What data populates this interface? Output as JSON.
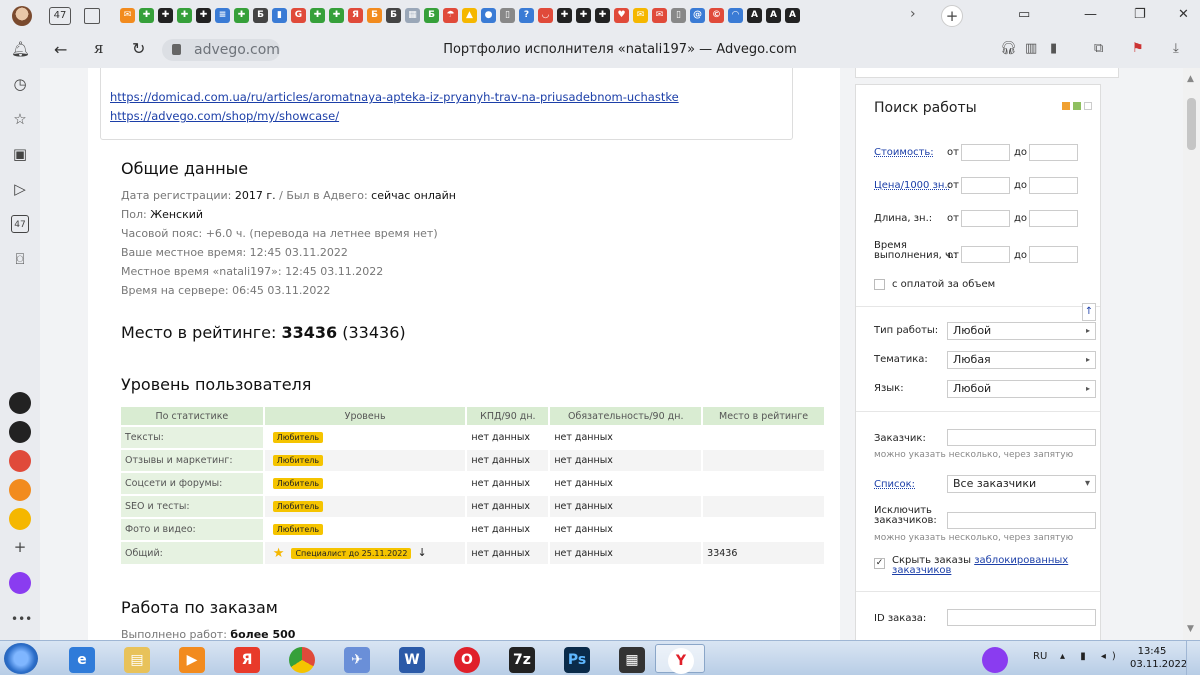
{
  "browser": {
    "tab_counter": "47",
    "url": "advego.com",
    "page_title": "Портфолио исполнителя «natali197» — Advego.com",
    "sidebar_counter": "47",
    "pinned_tab_count_text": "",
    "new_tab_symbol": "+",
    "tab_scroll_symbol": "›",
    "window_controls": [
      "▭",
      "—",
      "❐",
      "✕"
    ]
  },
  "links": [
    "https://domicad.com.ua/ru/articles/aromatnaya-apteka-iz-pryanyh-trav-na-priusadebnom-uchastke",
    "https://advego.com/shop/my/showcase/"
  ],
  "general": {
    "heading": "Общие данные",
    "reg_label": "Дата регистрации:",
    "reg_value": "2017 г.",
    "sep": "/",
    "seen_label": "Был в Адвего:",
    "seen_value": "сейчас онлайн",
    "gender_label": "Пол:",
    "gender_value": "Женский",
    "tz_line": "Часовой пояс: +6.0 ч. (перевода на летнее время нет)",
    "local_time_line": "Ваше местное время: 12:45 03.11.2022",
    "user_time_line": "Местное время «natali197»: 12:45 03.11.2022",
    "server_time_line": "Время на сервере: 06:45 03.11.2022"
  },
  "rating": {
    "label": "Место в рейтинге:",
    "value": "33436",
    "paren": "(33436)"
  },
  "level": {
    "heading": "Уровень пользователя",
    "columns": [
      "По статистике",
      "Уровень",
      "КПД/90 дн.",
      "Обязательность/90 дн.",
      "Место в рейтинге"
    ],
    "rows": [
      {
        "cat": "Тексты:",
        "level": "Любитель",
        "kpd": "нет данных",
        "oblig": "нет данных",
        "place": ""
      },
      {
        "cat": "Отзывы и маркетинг:",
        "level": "Любитель",
        "kpd": "нет данных",
        "oblig": "нет данных",
        "place": ""
      },
      {
        "cat": "Соцсети и форумы:",
        "level": "Любитель",
        "kpd": "нет данных",
        "oblig": "нет данных",
        "place": ""
      },
      {
        "cat": "SEO и тесты:",
        "level": "Любитель",
        "kpd": "нет данных",
        "oblig": "нет данных",
        "place": ""
      },
      {
        "cat": "Фото и видео:",
        "level": "Любитель",
        "kpd": "нет данных",
        "oblig": "нет данных",
        "place": ""
      },
      {
        "cat": "Общий:",
        "level": "Специалист до 25.11.2022",
        "kpd": "нет данных",
        "oblig": "нет данных",
        "place": "33436"
      }
    ]
  },
  "orders": {
    "heading": "Работа по заказам",
    "done_label": "Выполнено работ:",
    "done_value": "более 500"
  },
  "search": {
    "title": "Поиск работы",
    "cost_label": "Стоимость:",
    "price_label": "Цена/1000 зн.:",
    "length_label": "Длина, зн.:",
    "time_label_1": "Время",
    "time_label_2": "выполнения, ч.:",
    "from": "от",
    "to": "до",
    "volume_pay": "с оплатой за объем",
    "work_type_label": "Тип работы:",
    "work_type_value": "Любой",
    "topic_label": "Тематика:",
    "topic_value": "Любая",
    "lang_label": "Язык:",
    "lang_value": "Любой",
    "customer_label": "Заказчик:",
    "hint": "можно указать несколько, через запятую",
    "list_label": "Список:",
    "list_value": "Все заказчики",
    "exclude_label_1": "Исключить",
    "exclude_label_2": "заказчиков:",
    "hide_text": "Скрыть заказы",
    "hide_link_1": "заблокированных",
    "hide_link_2": "заказчиков",
    "order_id_label": "ID заказа:",
    "colors": [
      "#f0a030",
      "#8fc060",
      "#ffffff"
    ]
  },
  "taskbar": {
    "lang": "RU",
    "time": "13:45",
    "date": "03.11.2022"
  }
}
